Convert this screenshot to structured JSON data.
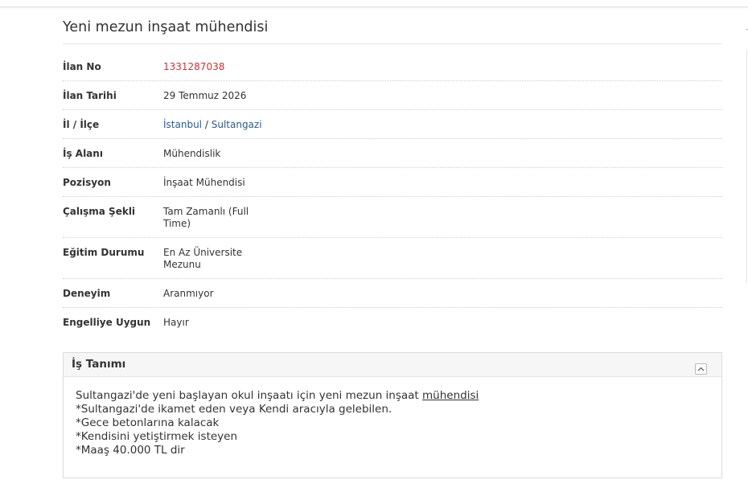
{
  "listing": {
    "title": "Yeni mezun inşaat mühendisi"
  },
  "details": {
    "ilan_no_label": "İlan No",
    "ilan_no": "1331287038",
    "ilan_tarihi_label": "İlan Tarihi",
    "ilan_tarihi": "29 Temmuz 2026",
    "il_ilce_label": "İl / İlçe",
    "il": "İstanbul",
    "separator": "/",
    "ilce": "Sultangazi",
    "is_alani_label": "İş Alanı",
    "is_alani": "Mühendislik",
    "pozisyon_label": "Pozisyon",
    "pozisyon": "İnşaat Mühendisi",
    "calisma_sekli_label": "Çalışma Şekli",
    "calisma_sekli": "Tam Zamanlı (Full Time)",
    "egitim_label": "Eğitim Durumu",
    "egitim": "En Az Üniversite Mezunu",
    "deneyim_label": "Deneyim",
    "deneyim": "Aranmıyor",
    "engelli_label": "Engelliye Uygun",
    "engelli": "Hayır"
  },
  "description": {
    "header": "İş Tanımı",
    "line1_prefix": "Sultangazi'de yeni başlayan okul inşaatı için yeni mezun inşaat ",
    "line1_link": "mühendisi",
    "line2": "*Sultangazi'de ikamet eden veya Kendi aracıyla gelebilen.",
    "line3": "*Gece betonlarına kalacak",
    "line4": "*Kendisini yetiştirmek isteyen",
    "line5": "*Maaş 40.000 TL dir"
  },
  "icons": {
    "collapse": "chevron-up-icon"
  },
  "colors": {
    "ilan_no": "#e5282e",
    "link": "#2b5a8c"
  }
}
